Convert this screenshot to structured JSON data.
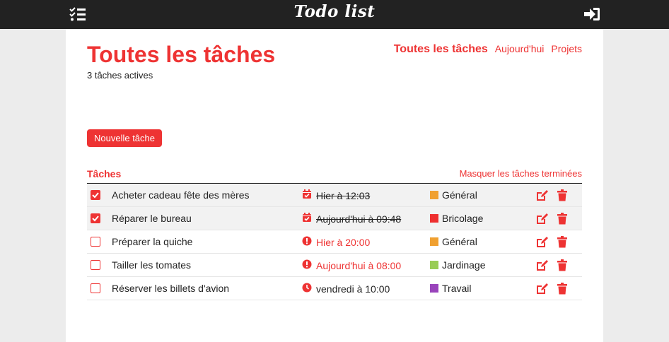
{
  "header": {
    "brand": "Todo list",
    "menu_icon": "checklist-icon",
    "login_icon": "sign-in-icon"
  },
  "page": {
    "title": "Toutes les tâches",
    "subtitle": "3 tâches actives"
  },
  "nav": {
    "all": "Toutes les tâches",
    "today": "Aujourd'hui",
    "projects": "Projets"
  },
  "actions": {
    "new_task": "Nouvelle tâche"
  },
  "section": {
    "label": "Tâches",
    "hide_done": "Masquer les tâches terminées"
  },
  "tasks": [
    {
      "title": "Acheter cadeau fête des mères",
      "done": true,
      "due": "Hier à 12:03",
      "due_state": "done",
      "project": "Général",
      "project_color": "#f0a030"
    },
    {
      "title": "Réparer le bureau",
      "done": true,
      "due": "Aujourd'hui à 09:48",
      "due_state": "done",
      "project": "Bricolage",
      "project_color": "#ee2f2f"
    },
    {
      "title": "Préparer la quiche",
      "done": false,
      "due": "Hier à 20:00",
      "due_state": "late",
      "project": "Général",
      "project_color": "#f0a030"
    },
    {
      "title": "Tailler les tomates",
      "done": false,
      "due": "Aujourd'hui à 08:00",
      "due_state": "late",
      "project": "Jardinage",
      "project_color": "#99cc55"
    },
    {
      "title": "Réserver les billets d'avion",
      "done": false,
      "due": "vendredi à 10:00",
      "due_state": "future",
      "project": "Travail",
      "project_color": "#9944bb"
    }
  ],
  "colors": {
    "accent": "#ee3333",
    "topbar": "#222222"
  }
}
